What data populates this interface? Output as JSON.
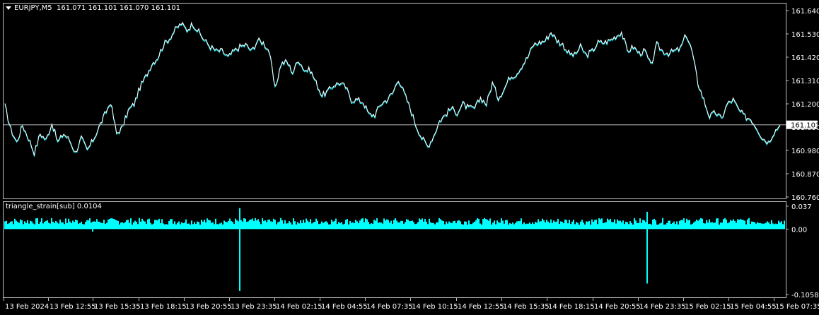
{
  "header": {
    "symbol": "EURJPY,M5",
    "ohlc": "161.071 161.101 161.070 161.101"
  },
  "indicator": {
    "title": "triangle_strain[sub] 0.0104"
  },
  "colors": {
    "background": "#000000",
    "frame": "#c0c0c0",
    "price_line": "#ffffff",
    "price_shadow": "#00e5ee",
    "histogram": "#00ffff",
    "bid_line": "#c0c0c0",
    "bid_box_bg": "#ffffff",
    "bid_box_fg": "#000000"
  },
  "chart_data": [
    {
      "type": "line",
      "name": "price",
      "current_price": "161.101",
      "y_ticks": [
        "161.640",
        "161.530",
        "161.420",
        "161.310",
        "161.200",
        "161.090",
        "160.980",
        "160.870",
        "160.760"
      ],
      "ylim": [
        160.76,
        161.64
      ],
      "x_labels": [
        "13 Feb 2024",
        "13 Feb 12:55",
        "13 Feb 15:35",
        "13 Feb 18:15",
        "13 Feb 20:55",
        "13 Feb 23:35",
        "14 Feb 02:15",
        "14 Feb 04:55",
        "14 Feb 07:35",
        "14 Feb 10:15",
        "14 Feb 12:55",
        "14 Feb 15:35",
        "14 Feb 18:15",
        "14 Feb 20:55",
        "14 Feb 23:35",
        "15 Feb 02:15",
        "15 Feb 04:55",
        "15 Feb 07:35"
      ],
      "y": [
        161.19,
        161.08,
        161.02,
        161.1,
        161.04,
        160.97,
        161.06,
        161.03,
        161.11,
        161.02,
        161.06,
        161.03,
        160.97,
        161.04,
        160.98,
        161.03,
        161.09,
        161.15,
        161.21,
        161.06,
        161.09,
        161.17,
        161.2,
        161.28,
        161.33,
        161.39,
        161.42,
        161.48,
        161.51,
        161.55,
        161.58,
        161.55,
        161.58,
        161.54,
        161.5,
        161.47,
        161.45,
        161.45,
        161.42,
        161.45,
        161.47,
        161.48,
        161.45,
        161.5,
        161.49,
        161.45,
        161.27,
        161.39,
        161.4,
        161.35,
        161.41,
        161.36,
        161.36,
        161.3,
        161.24,
        161.26,
        161.29,
        161.3,
        161.28,
        161.22,
        161.22,
        161.21,
        161.15,
        161.15,
        161.2,
        161.22,
        161.25,
        161.32,
        161.25,
        161.18,
        161.1,
        161.04,
        161.0,
        161.05,
        161.12,
        161.15,
        161.18,
        161.16,
        161.2,
        161.18,
        161.18,
        161.23,
        161.2,
        161.3,
        161.23,
        161.27,
        161.33,
        161.34,
        161.38,
        161.42,
        161.48,
        161.49,
        161.5,
        161.54,
        161.5,
        161.48,
        161.44,
        161.43,
        161.47,
        161.43,
        161.45,
        161.49,
        161.49,
        161.5,
        161.52,
        161.54,
        161.45,
        161.47,
        161.44,
        161.45,
        161.38,
        161.48,
        161.45,
        161.44,
        161.45,
        161.46,
        161.53,
        161.45,
        161.3,
        161.22,
        161.14,
        161.16,
        161.13,
        161.2,
        161.22,
        161.17,
        161.14,
        161.13,
        161.09,
        161.04,
        161.02,
        161.07,
        161.1
      ],
      "y_approx_note": ""
    },
    {
      "type": "bar",
      "name": "triangle_strain[sub]",
      "value": 0.0104,
      "y_ticks": [
        "0.037",
        "0.00",
        "-0.1058"
      ],
      "ylim": [
        -0.1058,
        0.037
      ],
      "baseline": 0.0,
      "typical_value": 0.012,
      "spikes": [
        {
          "index_fraction": 0.113,
          "value": -0.004
        },
        {
          "index_fraction": 0.3,
          "value": -0.1,
          "up": 0.034
        },
        {
          "index_fraction": 0.822,
          "value": -0.088,
          "up": 0.028
        }
      ]
    }
  ]
}
